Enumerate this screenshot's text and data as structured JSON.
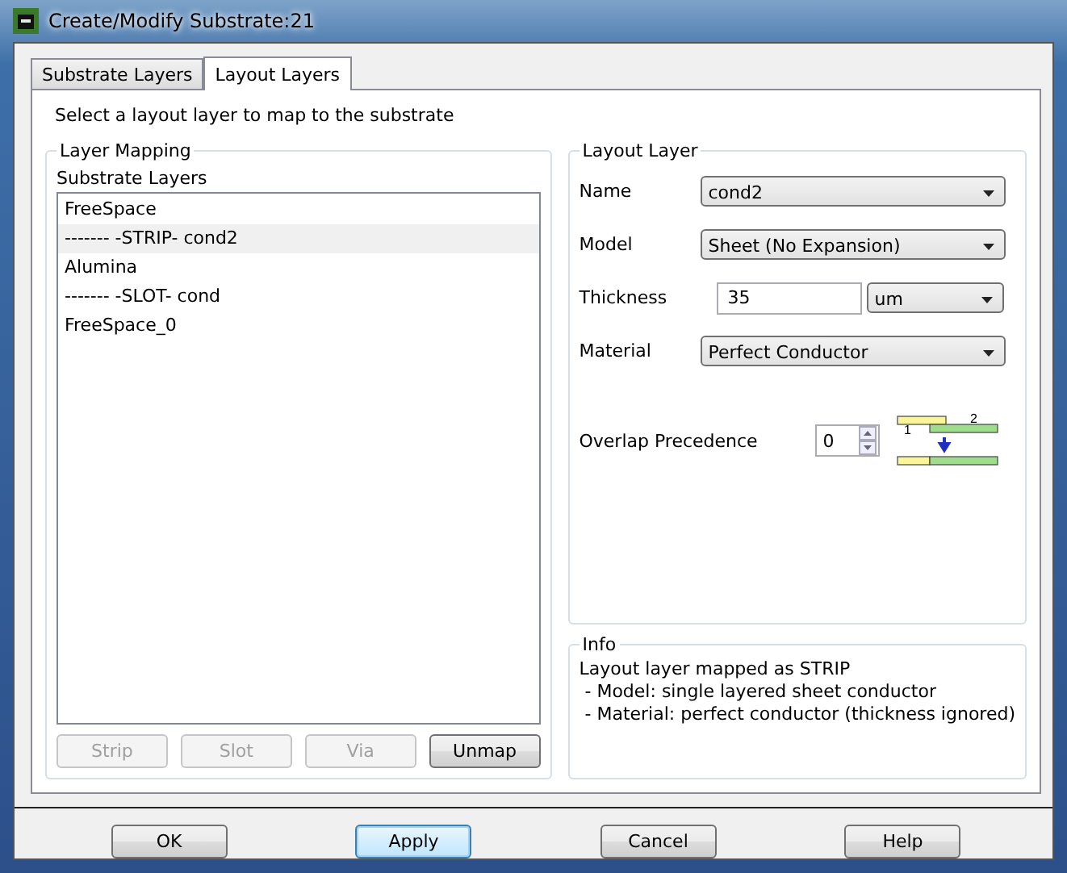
{
  "window": {
    "title": "Create/Modify Substrate:21"
  },
  "tabs": [
    {
      "label": "Substrate Layers",
      "selected": false
    },
    {
      "label": "Layout Layers",
      "selected": true
    }
  ],
  "instruction": "Select a layout layer to map to the substrate",
  "layer_mapping": {
    "title": "Layer Mapping",
    "list_label": "Substrate Layers",
    "items": [
      {
        "label": "FreeSpace",
        "selected": false
      },
      {
        "label": "------- -STRIP- cond2",
        "selected": true
      },
      {
        "label": "Alumina",
        "selected": false
      },
      {
        "label": "------- -SLOT- cond",
        "selected": false
      },
      {
        "label": "FreeSpace_0",
        "selected": false
      }
    ],
    "buttons": [
      {
        "label": "Strip",
        "disabled": true
      },
      {
        "label": "Slot",
        "disabled": true
      },
      {
        "label": "Via",
        "disabled": true
      },
      {
        "label": "Unmap",
        "disabled": false
      }
    ]
  },
  "layout_layer": {
    "title": "Layout Layer",
    "name": {
      "label": "Name",
      "value": "cond2"
    },
    "model": {
      "label": "Model",
      "value": "Sheet (No Expansion)"
    },
    "thickness": {
      "label": "Thickness",
      "value": "35",
      "unit": "um"
    },
    "material": {
      "label": "Material",
      "value": "Perfect Conductor"
    },
    "overlap": {
      "label": "Overlap Precedence",
      "value": "0",
      "diagram_labels": [
        "2",
        "1"
      ]
    }
  },
  "info": {
    "title": "Info",
    "lines": [
      "Layout layer mapped as STRIP",
      " - Model: single layered sheet conductor",
      " - Material: perfect conductor (thickness ignored)"
    ]
  },
  "buttons": [
    {
      "label": "OK",
      "default": false
    },
    {
      "label": "Apply",
      "default": true
    },
    {
      "label": "Cancel",
      "default": false
    },
    {
      "label": "Help",
      "default": false
    }
  ]
}
